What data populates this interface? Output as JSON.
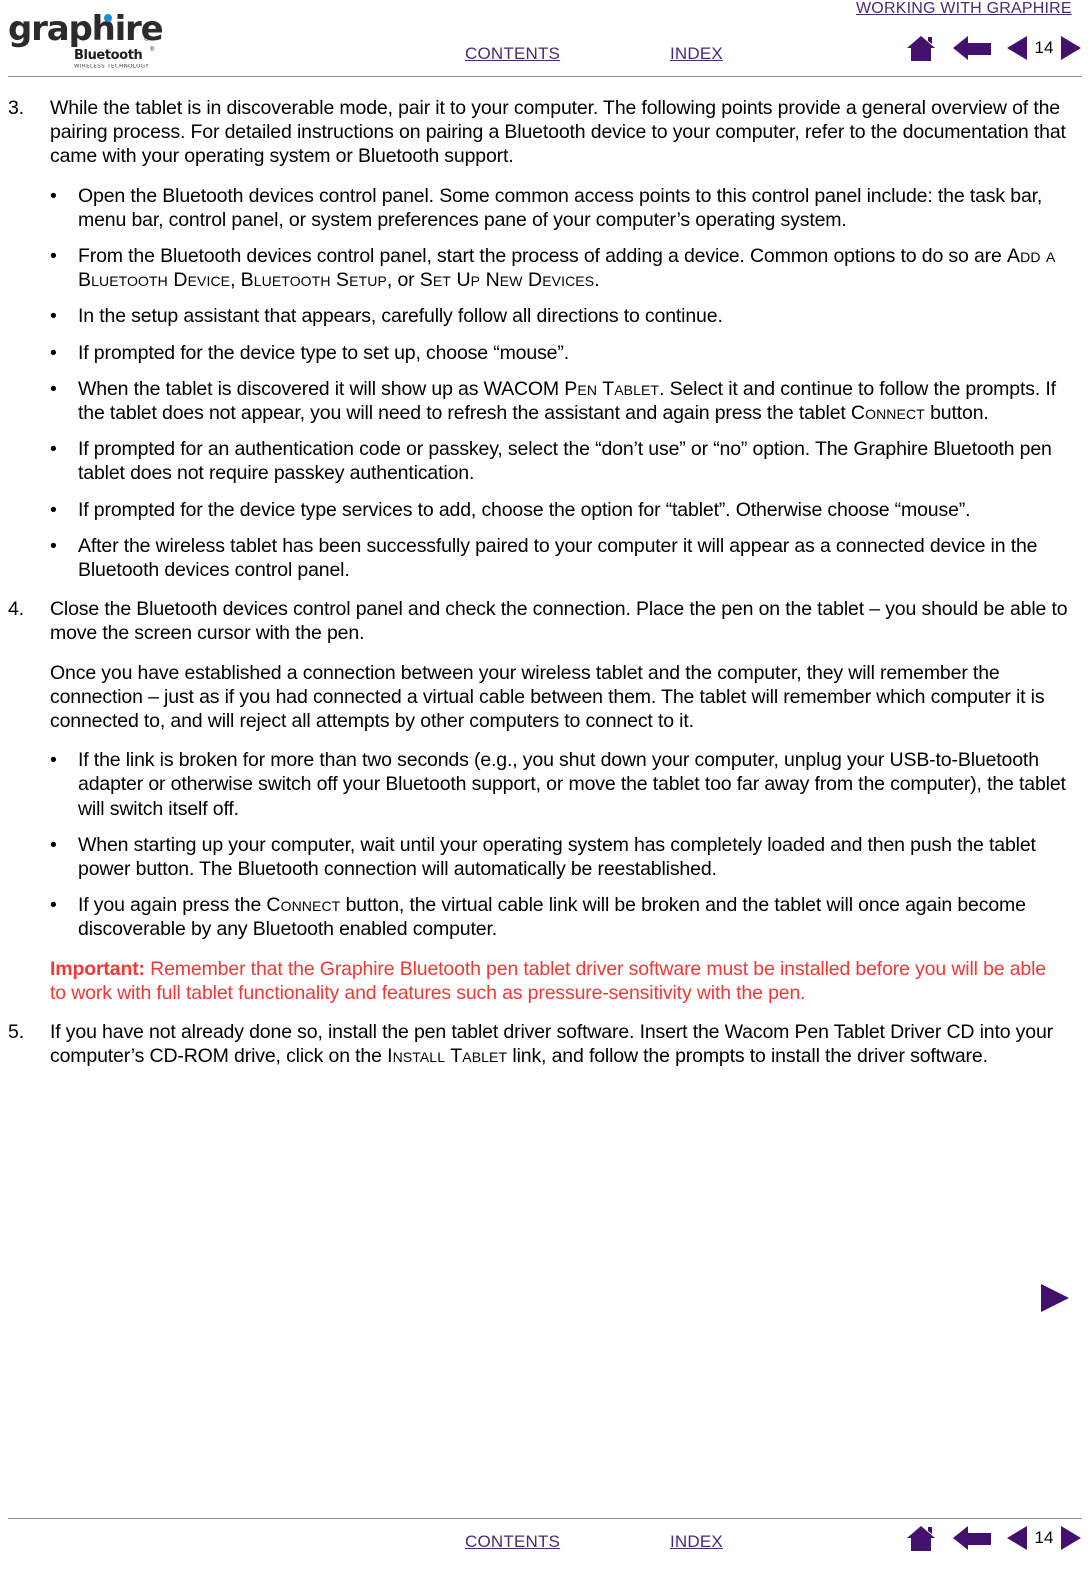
{
  "logo": {
    "wordmark": "graphire",
    "registered": "®",
    "sub_brand": "Bluetooth",
    "sub_brand_registered": "®",
    "tagline": "WIRELESS TECHNOLOGY",
    "dot_color": "#1a8fd6",
    "text_color": "#2b2b2b"
  },
  "header": {
    "section_title": "WORKING WITH GRAPHIRE",
    "contents_label": "CONTENTS",
    "index_label": "INDEX",
    "page_number": "14",
    "link_color": "#4b2a74",
    "icon_color": "#43106e",
    "icons": [
      {
        "name": "home-icon",
        "title": "Go to title page"
      },
      {
        "name": "back-arrow-icon",
        "title": "Go back"
      },
      {
        "name": "previous-page-icon",
        "title": "Previous page"
      },
      {
        "name": "next-page-icon",
        "title": "Next page"
      }
    ]
  },
  "footer": {
    "contents_label": "CONTENTS",
    "index_label": "INDEX",
    "page_number": "14",
    "link_color": "#4b2a74",
    "icon_color": "#43106e"
  },
  "content": {
    "bullet_glyph": "•",
    "step3": {
      "number": "3.",
      "text": "While the tablet is in discoverable mode, pair it to your computer.  The following points provide a general overview of the pairing process.  For detailed instructions on pairing a Bluetooth device to your computer, refer to the documentation that came with your operating system or Bluetooth support."
    },
    "step3_bullets": [
      {
        "parts": [
          {
            "type": "text",
            "value": "Open the Bluetooth devices control panel.  Some common access points to this control panel include: the task bar, menu bar, control panel, or system preferences pane of your computer’s operating system."
          }
        ]
      },
      {
        "parts": [
          {
            "type": "text",
            "value": "From the Bluetooth devices control panel, start the process of adding a device.  Common options to do so are "
          },
          {
            "type": "smallcaps",
            "value": "Add a Bluetooth Device"
          },
          {
            "type": "text",
            "value": ", "
          },
          {
            "type": "smallcaps",
            "value": "Bluetooth Setup"
          },
          {
            "type": "text",
            "value": ", or "
          },
          {
            "type": "smallcaps",
            "value": "Set Up New Devices"
          },
          {
            "type": "text",
            "value": "."
          }
        ]
      },
      {
        "parts": [
          {
            "type": "text",
            "value": "In the setup assistant that appears, carefully follow all directions to continue."
          }
        ]
      },
      {
        "parts": [
          {
            "type": "text",
            "value": "If prompted for the device type to set up, choose “mouse”."
          }
        ]
      },
      {
        "parts": [
          {
            "type": "text",
            "value": "When the tablet is discovered it will show up as WACOM "
          },
          {
            "type": "smallcaps",
            "value": "Pen Tablet"
          },
          {
            "type": "text",
            "value": ".  Select it and continue to follow the prompts.  If the tablet does not appear, you will need to refresh the assistant and again press the tablet "
          },
          {
            "type": "smallcaps",
            "value": "Connect"
          },
          {
            "type": "text",
            "value": " button."
          }
        ]
      },
      {
        "parts": [
          {
            "type": "text",
            "value": "If prompted for an authentication code or passkey, select the “don’t use” or “no” option.  The Graphire Bluetooth pen tablet does not require passkey authentication."
          }
        ]
      },
      {
        "parts": [
          {
            "type": "text",
            "value": "If prompted for the device type services to add, choose the option for “tablet”.  Otherwise choose “mouse”."
          }
        ]
      },
      {
        "parts": [
          {
            "type": "text",
            "value": "After the wireless tablet has been successfully paired to your computer it will appear as a connected device in the Bluetooth devices control panel."
          }
        ]
      }
    ],
    "step4": {
      "number": "4.",
      "text": "Close the Bluetooth devices control panel and check the connection.  Place the pen on the tablet – you should be able to move the screen cursor with the pen."
    },
    "step4_para": "Once you have established a connection between your wireless tablet and the computer, they will remember the connection – just as if you had connected a virtual cable between them.  The tablet will remember which computer it is connected to, and will reject all attempts by other computers to connect to it.",
    "step4_bullets": [
      {
        "parts": [
          {
            "type": "text",
            "value": "If the link is broken for more than two seconds (e.g., you shut down your computer, unplug your USB-to-Bluetooth adapter or otherwise switch off your Bluetooth support, or move the tablet too far away from the computer), the tablet will switch itself off."
          }
        ]
      },
      {
        "parts": [
          {
            "type": "text",
            "value": "When starting up your computer, wait until your operating system has completely loaded and then push the tablet power button.  The Bluetooth connection will automatically be reestablished."
          }
        ]
      },
      {
        "parts": [
          {
            "type": "text",
            "value": "If you again press the "
          },
          {
            "type": "smallcaps",
            "value": "Connect"
          },
          {
            "type": "text",
            "value": " button, the virtual cable link will be broken and the tablet will once again become discoverable by any Bluetooth enabled computer."
          }
        ]
      }
    ],
    "important": {
      "label": "Important:",
      "text": " Remember that the Graphire Bluetooth pen tablet driver software must be installed before you will be able to work with full tablet functionality and features such as pressure-sensitivity with the pen.",
      "color": "#ed3a37"
    },
    "step5": {
      "number": "5.",
      "parts": [
        {
          "type": "text",
          "value": "If you have not already done so, install the pen tablet driver software.  Insert the Wacom Pen Tablet Driver CD into your computer’s CD-ROM drive, click on the "
        },
        {
          "type": "smallcaps",
          "value": "Install Tablet"
        },
        {
          "type": "text",
          "value": " link, and follow the prompts to install the driver software."
        }
      ]
    },
    "next_arrow": {
      "name": "next-page-icon",
      "title": "Next page"
    }
  }
}
